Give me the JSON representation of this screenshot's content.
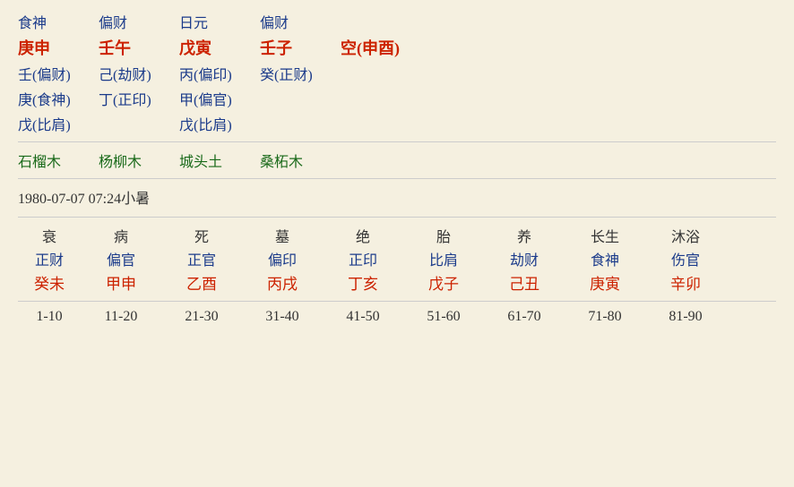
{
  "header": {
    "row1": {
      "items": [
        "食神",
        "偏财",
        "日元",
        "偏财"
      ]
    },
    "row2": {
      "stems": [
        "庚申",
        "壬午",
        "戊寅",
        "壬子"
      ],
      "note": "空(申酉)"
    },
    "hidden_stems": [
      [
        "壬(偏财)",
        "己(劫财)",
        "丙(偏印)",
        "癸(正财)"
      ],
      [
        "庚(食神)",
        "丁(正印)",
        "甲(偏官)",
        ""
      ],
      [
        "戊(比肩)",
        "",
        "戊(比肩)",
        ""
      ]
    ],
    "nayin": [
      "石榴木",
      "杨柳木",
      "城头土",
      "桑柘木"
    ],
    "date": "1980-07-07 07:24小暑"
  },
  "dasun": {
    "labels": [
      "衰",
      "病",
      "死",
      "墓",
      "绝",
      "胎",
      "养",
      "长生",
      "沐浴"
    ],
    "shishen": [
      "正财",
      "偏官",
      "正官",
      "偏印",
      "正印",
      "比肩",
      "劫财",
      "食神",
      "伤官"
    ],
    "ganzhi": [
      "癸未",
      "甲申",
      "乙酉",
      "丙戌",
      "丁亥",
      "戊子",
      "己丑",
      "庚寅",
      "辛卯"
    ],
    "ranges": [
      "1-10",
      "11-20",
      "21-30",
      "31-40",
      "41-50",
      "51-60",
      "61-70",
      "71-80",
      "81-90"
    ]
  }
}
